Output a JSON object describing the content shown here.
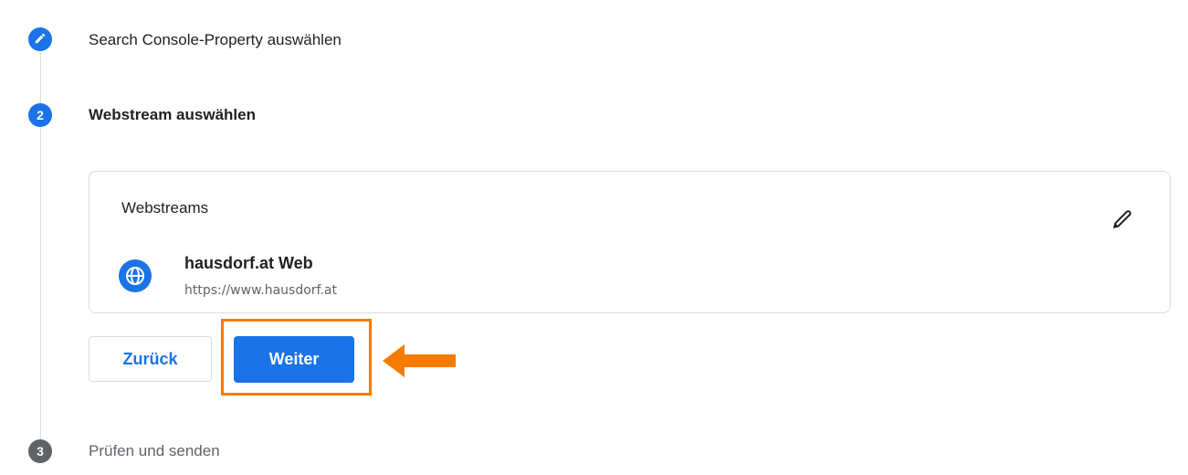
{
  "steps": [
    {
      "label": "Search Console-Property auswählen",
      "state": "completed"
    },
    {
      "number": "2",
      "label": "Webstream auswählen",
      "state": "active"
    },
    {
      "number": "3",
      "label": "Prüfen und senden",
      "state": "pending"
    }
  ],
  "card": {
    "title": "Webstreams",
    "stream": {
      "name": "hausdorf.at Web",
      "url": "https://www.hausdorf.at"
    }
  },
  "buttons": {
    "back_label": "Zurück",
    "next_label": "Weiter"
  },
  "colors": {
    "primary": "#1a73e8",
    "highlight": "#f57c00",
    "pending_step": "#5f6368"
  }
}
